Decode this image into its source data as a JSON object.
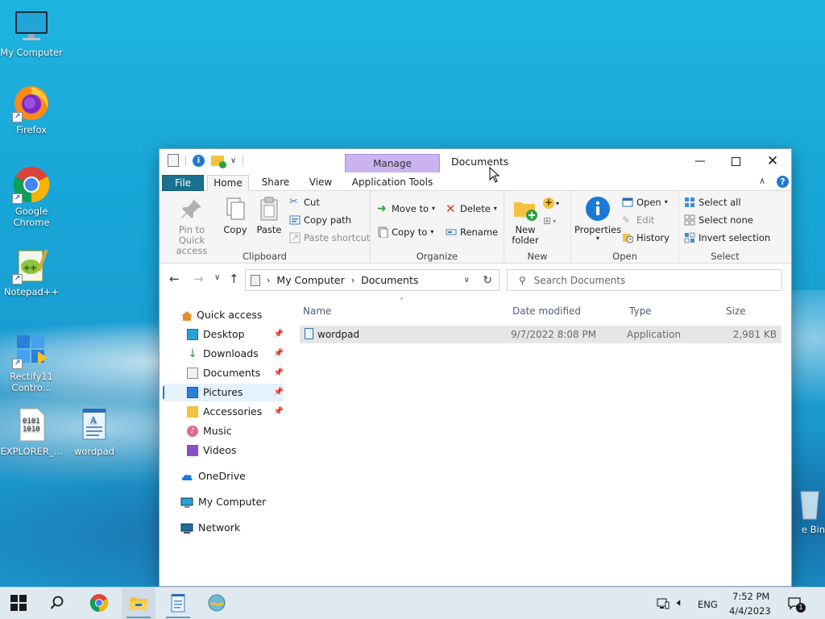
{
  "desktop": {
    "icons": [
      {
        "label": "My Computer"
      },
      {
        "label": "Firefox"
      },
      {
        "label": "Google Chrome"
      },
      {
        "label": "Notepad++"
      },
      {
        "label": "Rectify11 Contro..."
      },
      {
        "label": "EXPLORER_..."
      },
      {
        "label": "wordpad"
      },
      {
        "label": "e Bin"
      }
    ]
  },
  "window": {
    "title": "Documents",
    "context_tab": "Manage",
    "tabs": [
      "File",
      "Home",
      "Share",
      "View",
      "Application Tools"
    ],
    "ribbon": {
      "clipboard": {
        "label": "Clipboard",
        "pin_label": "Pin to Quick access",
        "copy_label": "Copy",
        "paste_label": "Paste",
        "cut_label": "Cut",
        "copy_path_label": "Copy path",
        "paste_shortcut_label": "Paste shortcut"
      },
      "organize": {
        "label": "Organize",
        "move_to_label": "Move to",
        "copy_to_label": "Copy to",
        "delete_label": "Delete",
        "rename_label": "Rename"
      },
      "new": {
        "label": "New",
        "new_folder_label": "New folder"
      },
      "open": {
        "label": "Open",
        "properties_label": "Properties",
        "open_label": "Open",
        "edit_label": "Edit",
        "history_label": "History"
      },
      "select": {
        "label": "Select",
        "select_all_label": "Select all",
        "select_none_label": "Select none",
        "invert_label": "Invert selection"
      }
    },
    "address": {
      "segments": [
        "My Computer",
        "Documents"
      ],
      "search_placeholder": "Search Documents"
    },
    "nav": {
      "quick_access": "Quick access",
      "items": [
        {
          "label": "Desktop"
        },
        {
          "label": "Downloads"
        },
        {
          "label": "Documents"
        },
        {
          "label": "Pictures"
        },
        {
          "label": "Accessories"
        },
        {
          "label": "Music"
        },
        {
          "label": "Videos"
        }
      ],
      "onedrive": "OneDrive",
      "my_computer": "My Computer",
      "network": "Network"
    },
    "columns": {
      "name": "Name",
      "date": "Date modified",
      "type": "Type",
      "size": "Size"
    },
    "files": [
      {
        "name": "wordpad",
        "date": "9/7/2022 8:08 PM",
        "type": "Application",
        "size": "2,981 KB"
      }
    ]
  },
  "taskbar": {
    "language": "ENG",
    "time": "7:52 PM",
    "date": "4/4/2023",
    "notification_count": "1"
  }
}
